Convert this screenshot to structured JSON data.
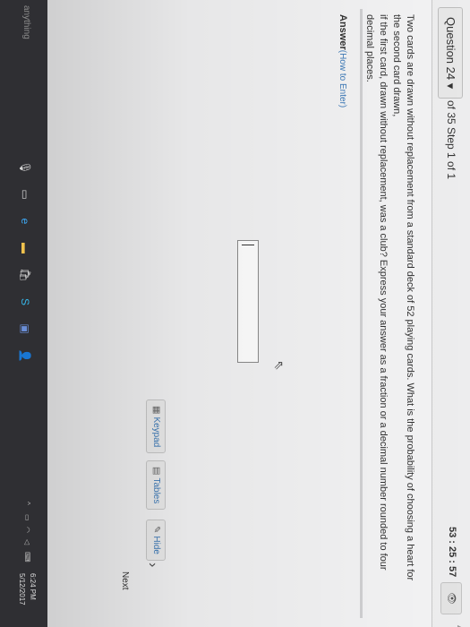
{
  "header": {
    "question_label": "Question 24",
    "dropdown_glyph": "▾",
    "step_text": "of 35 Step 1 of 1",
    "timer": "53 : 25 : 57",
    "eye_icon_glyph": "👁"
  },
  "question": {
    "line1": "Two cards are drawn without replacement from a standard deck of 52 playing cards. What is the probability of choosing a heart for the second card drawn,",
    "line2": "if the first card, drawn without replacement, was a club? Express your answer as a fraction or a decimal number rounded to four decimal places."
  },
  "answer": {
    "label": "Answer",
    "howto": "(How to Enter)",
    "value": ""
  },
  "tools": {
    "keypad": "Keypad",
    "tables": "Tables",
    "hide": "Hide"
  },
  "nav": {
    "next_label": "Next",
    "next_glyph": "›"
  },
  "taskbar": {
    "search_text": "anything",
    "time": "6:24 PM",
    "date": "5/12/2017"
  },
  "colors": {
    "link": "#3d7ab8",
    "taskbar": "#2f2f33",
    "edge_blue": "#1e88e5"
  }
}
